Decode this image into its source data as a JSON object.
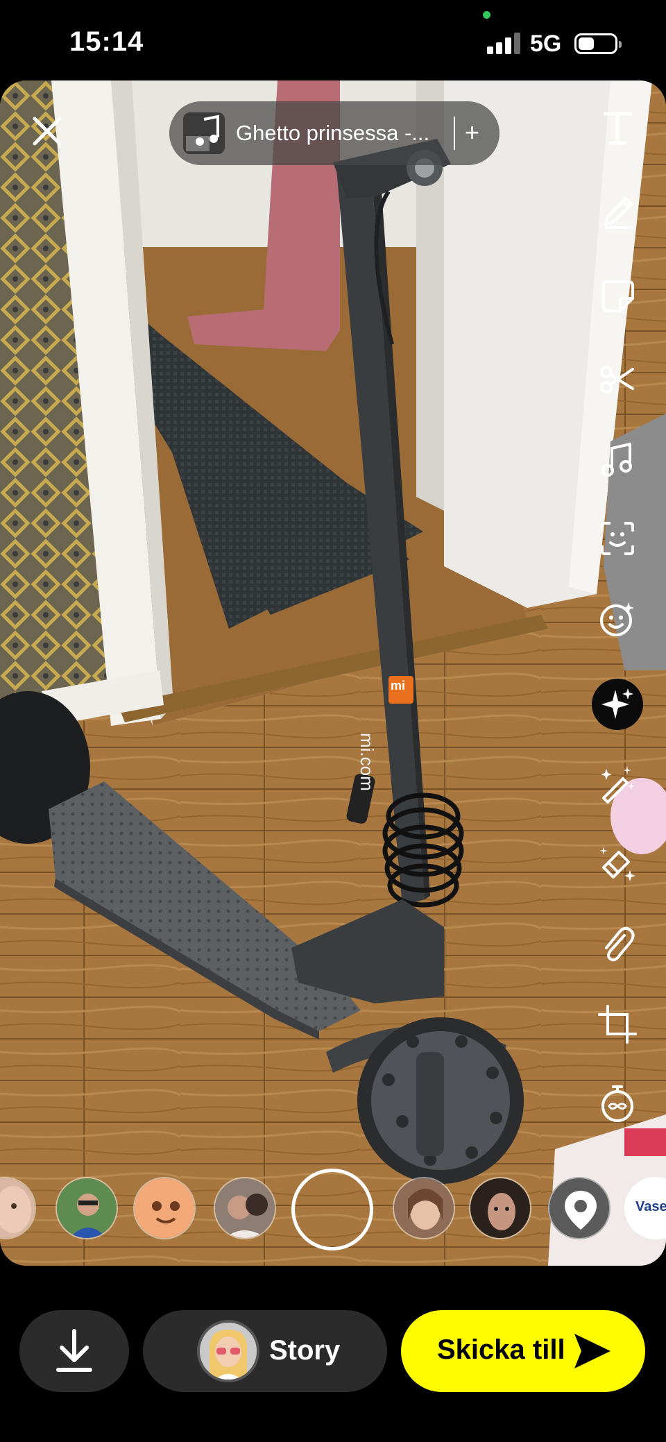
{
  "status_bar": {
    "time": "15:14",
    "network": "5G",
    "signal_bars_filled": 3,
    "signal_bars_total": 4,
    "battery_level": 0.35
  },
  "photo_overlay": {
    "music": {
      "title": "Ghetto prinsessa -...",
      "add_symbol": "+"
    },
    "scene_text": {
      "brand_logo": "mi",
      "brand_url": "mi.com",
      "product_box": "Vaseli"
    }
  },
  "tools": [
    {
      "name": "text-tool-icon"
    },
    {
      "name": "pencil-draw-icon"
    },
    {
      "name": "sticker-icon"
    },
    {
      "name": "scissors-icon"
    },
    {
      "name": "music-note-icon"
    },
    {
      "name": "scan-face-icon"
    },
    {
      "name": "lens-face-icon"
    },
    {
      "name": "ai-sparkle-icon"
    },
    {
      "name": "magic-wand-icon"
    },
    {
      "name": "eraser-sparkle-icon"
    },
    {
      "name": "paperclip-icon"
    },
    {
      "name": "crop-icon"
    },
    {
      "name": "timer-infinity-icon"
    }
  ],
  "bottom_bar": {
    "save_icon": "download-icon",
    "story_label": "Story",
    "send_label": "Skicka till",
    "send_icon": "send-arrow-icon"
  },
  "colors": {
    "background": "#000000",
    "pill": "#2b2b2b",
    "send_button": "#fffc00",
    "status_green": "#34c759"
  }
}
